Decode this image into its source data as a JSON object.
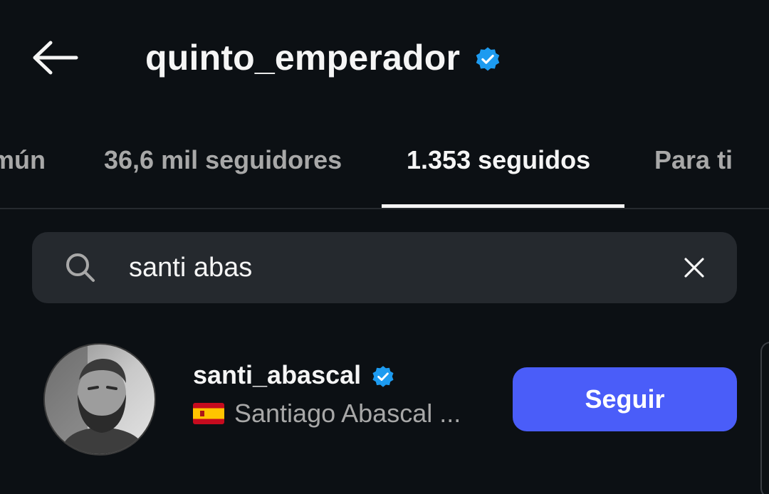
{
  "header": {
    "title": "quinto_emperador",
    "verified_icon": "verified-badge-icon",
    "back_icon": "arrow-left-icon"
  },
  "tabs": [
    {
      "label": "mún",
      "active": false
    },
    {
      "label": "36,6 mil seguidores",
      "active": false
    },
    {
      "label": "1.353 seguidos",
      "active": true
    },
    {
      "label": "Para ti",
      "active": false
    }
  ],
  "search": {
    "value": "santi abas",
    "icon": "search-icon",
    "clear_icon": "close-icon"
  },
  "results": [
    {
      "username": "santi_abascal",
      "verified": true,
      "flag": "🇪🇸",
      "full_name": "Santiago Abascal ...",
      "button_label": "Seguir"
    }
  ],
  "colors": {
    "background": "#0c1014",
    "search_bg": "#25292e",
    "verified": "#1d9bf0",
    "follow_button": "#4a5df9",
    "secondary_text": "#a8a8a8",
    "primary_text": "#f5f5f5"
  }
}
